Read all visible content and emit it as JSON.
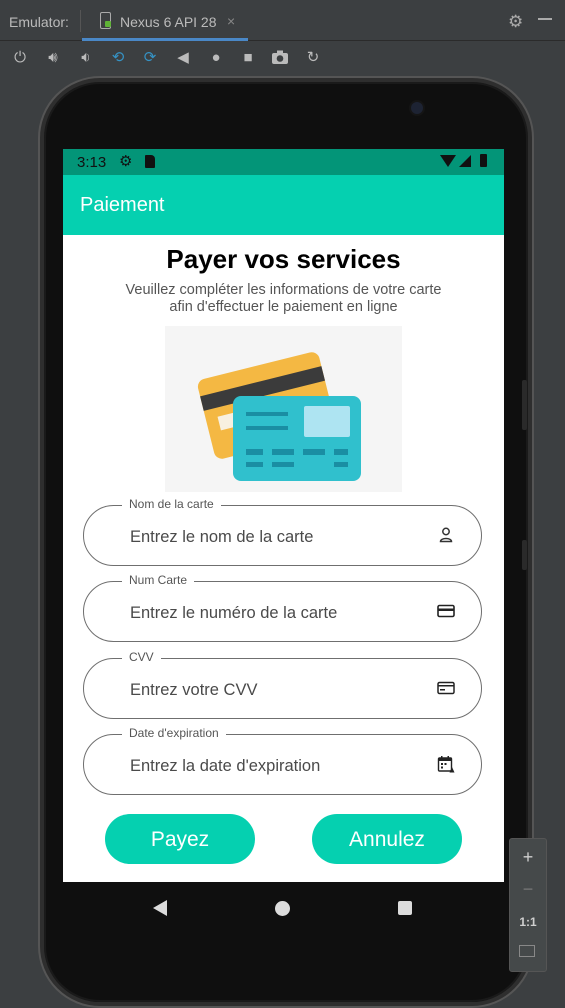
{
  "emulator": {
    "label": "Emulator:",
    "tab_name": "Nexus 6 API 28",
    "close_glyph": "×",
    "settings_icon": "gear-icon",
    "minimize_icon": "minimize-icon",
    "toolbar_icons": [
      "power-icon",
      "volume-up-icon",
      "volume-down-icon",
      "rotate-left-icon",
      "rotate-right-icon",
      "back-icon",
      "home-icon",
      "overview-icon",
      "camera-icon",
      "zoom-icon"
    ],
    "zoom": {
      "plus": "+",
      "minus": "−",
      "one_to_one": "1:1"
    }
  },
  "status_bar": {
    "time": "3:13"
  },
  "app_bar": {
    "title": "Paiement"
  },
  "page": {
    "title": "Payer vos services",
    "subtitle": "Veuillez compléter les informations de votre carte afin d'effectuer le paiement en ligne"
  },
  "form": {
    "fields": [
      {
        "label": "Nom de la carte",
        "placeholder": "Entrez le nom de la carte",
        "icon": "person-icon"
      },
      {
        "label": "Num Carte",
        "placeholder": "Entrez le numéro de la carte",
        "icon": "credit-card-icon"
      },
      {
        "label": "CVV",
        "placeholder": "Entrez votre CVV",
        "icon": "card-icon"
      },
      {
        "label": "Date d'expiration",
        "placeholder": "Entrez la date d'expiration",
        "icon": "calendar-icon"
      }
    ]
  },
  "buttons": {
    "pay": "Payez",
    "cancel": "Annulez"
  },
  "colors": {
    "accent": "#05d0b0",
    "status_bar": "#039578",
    "card_back": "#f4b843",
    "card_front": "#30c0cd"
  }
}
